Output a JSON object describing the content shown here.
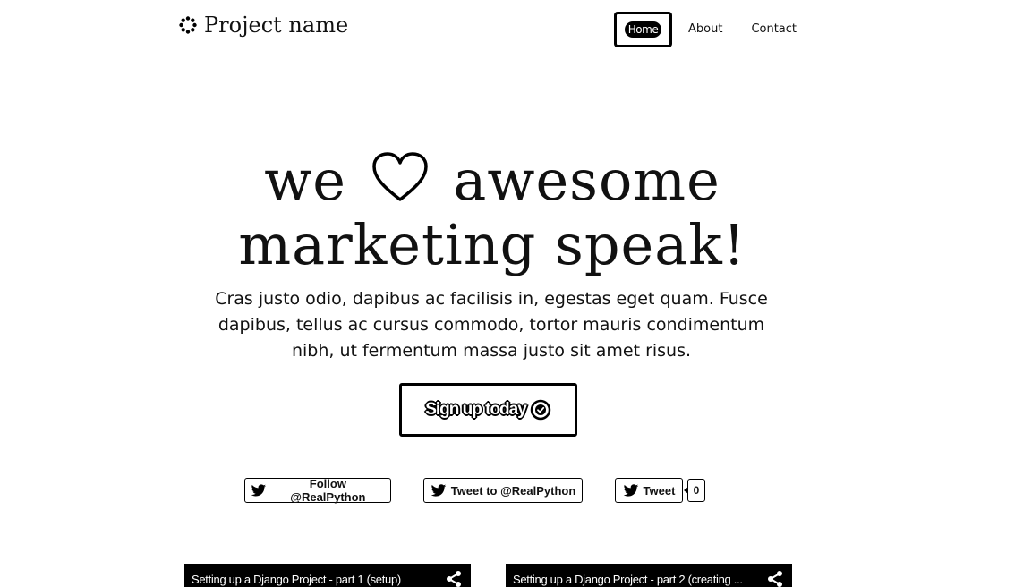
{
  "header": {
    "brand": "Project name",
    "nav": [
      {
        "label": "Home",
        "active": true
      },
      {
        "label": "About",
        "active": false
      },
      {
        "label": "Contact",
        "active": false
      }
    ]
  },
  "hero": {
    "title_line1_before": "we",
    "title_line1_after": "awesome",
    "title_line2": "marketing speak!",
    "lead": "Cras justo odio, dapibus ac facilisis in, egestas eget quam. Fusce dapibus, tellus ac cursus commodo, tortor mauris condimentum nibh, ut fermentum massa justo sit amet risus.",
    "cta_label": "Sign up today"
  },
  "social": {
    "follow_label": "Follow @RealPython",
    "tweet_to_label": "Tweet to @RealPython",
    "tweet_label": "Tweet",
    "tweet_count": "0"
  },
  "videos": [
    {
      "title": "Setting up a Django Project - part 1 (setup)"
    },
    {
      "title": "Setting up a Django Project - part 2 (creating ..."
    }
  ],
  "icons": {
    "brand": "spinner-icon",
    "heart": "heart-icon",
    "cta": "check-circle-icon",
    "twitter": "twitter-bird-icon",
    "share": "share-icon"
  },
  "colors": {
    "background": "#ffffff",
    "foreground": "#000000"
  }
}
